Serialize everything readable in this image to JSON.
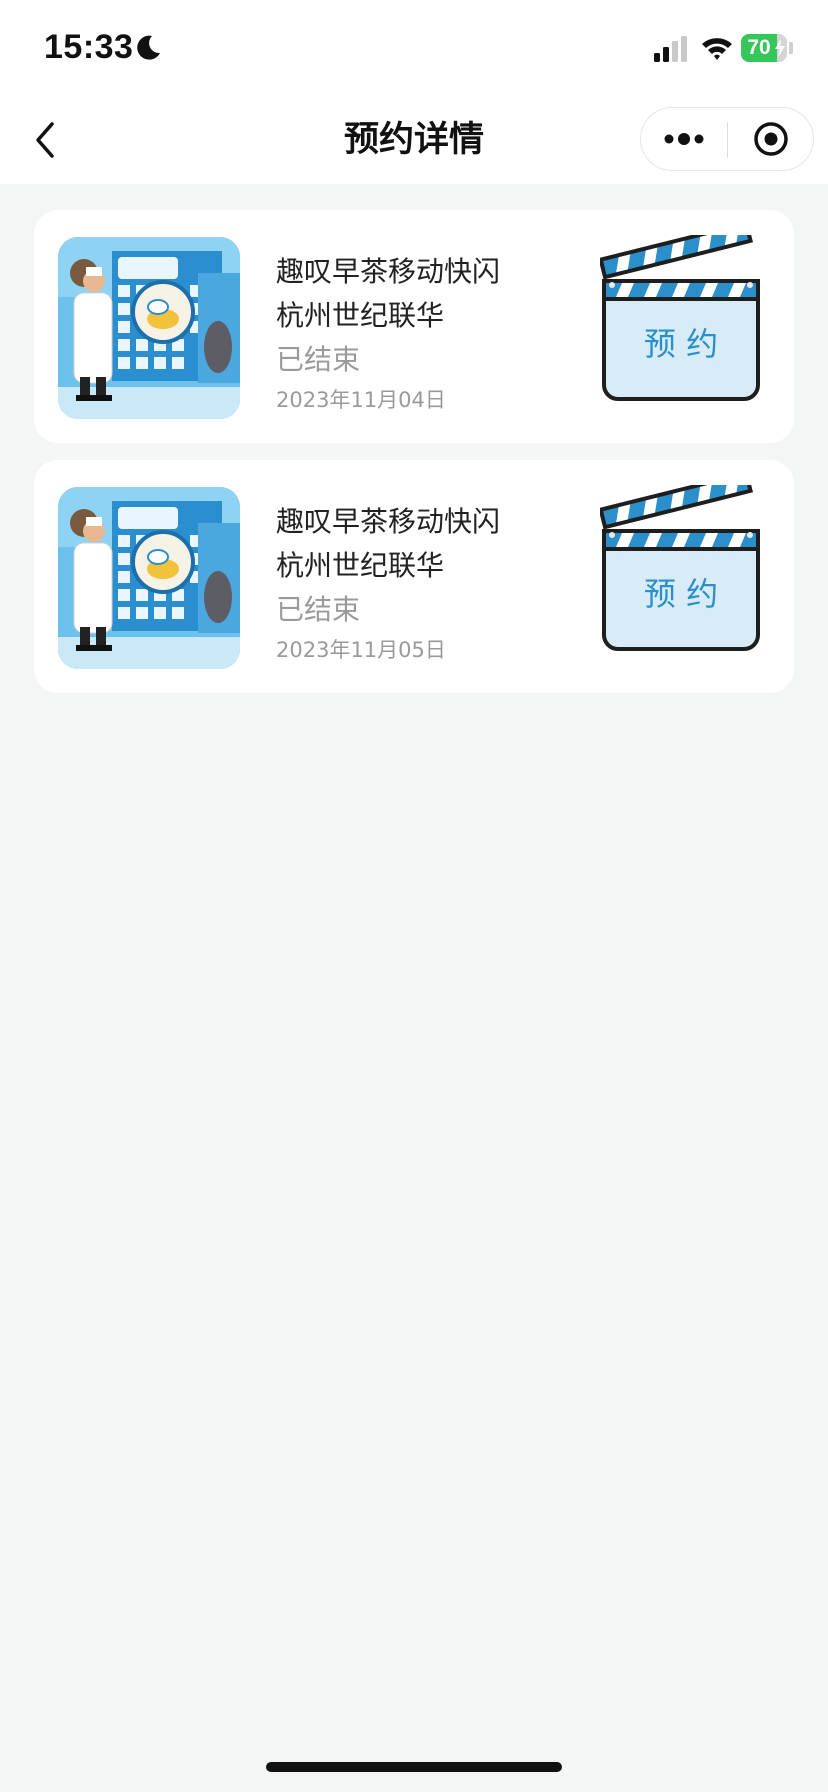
{
  "status_bar": {
    "time": "15:33",
    "battery_level": "70",
    "battery_color": "#35c759"
  },
  "nav": {
    "title": "预约详情",
    "back_icon": "chevron-left-icon",
    "more_icon": "more-dots-icon",
    "close_icon": "target-circle-icon"
  },
  "reservations": [
    {
      "title": "趣叹早茶移动快闪",
      "location": "杭州世纪联华",
      "status": "已结束",
      "date": "2023年11月04日",
      "button_label": "预 约"
    },
    {
      "title": "趣叹早茶移动快闪",
      "location": "杭州世纪联华",
      "status": "已结束",
      "date": "2023年11月05日",
      "button_label": "预 约"
    }
  ],
  "colors": {
    "background": "#f4f5f5",
    "clapper_blue": "#2a8fca",
    "clapper_fill": "#d8ecf8"
  }
}
